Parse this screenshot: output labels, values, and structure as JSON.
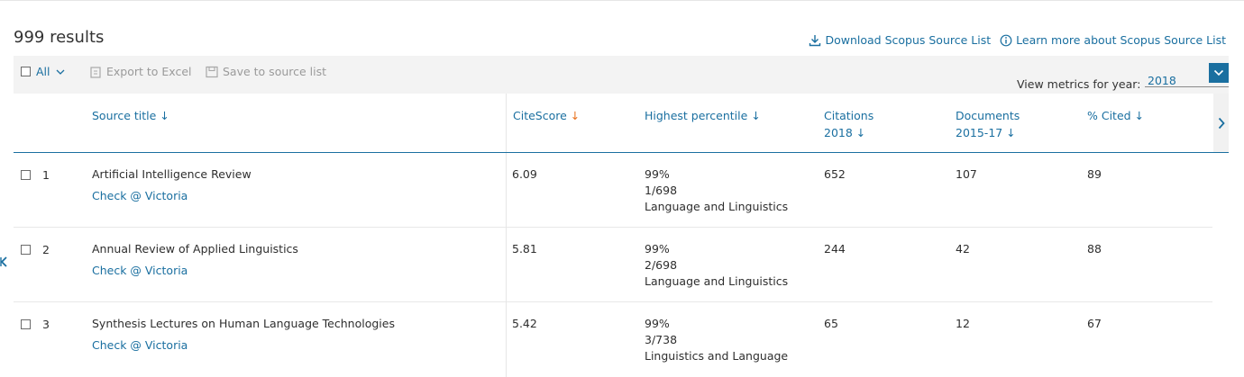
{
  "results_label": "999 results",
  "top_links": {
    "download": "Download Scopus Source List",
    "learn_more": "Learn more about Scopus Source List"
  },
  "toolbar": {
    "all_label": "All",
    "export_label": "Export to Excel",
    "save_label": "Save to source list",
    "year_label": "View metrics for year:",
    "year_value": "2018"
  },
  "headers": {
    "source_title": "Source title",
    "citescore": "CiteScore",
    "highest_percentile": "Highest percentile",
    "citations_line1": "Citations",
    "citations_line2": "2018",
    "documents_line1": "Documents",
    "documents_line2": "2015-17",
    "cited": "% Cited"
  },
  "rows": [
    {
      "num": "1",
      "title": "Artificial Intelligence Review",
      "link": "Check @ Victoria",
      "citescore": "6.09",
      "pct": "99%",
      "rank": "1/698",
      "category": "Language and Linguistics",
      "citations": "652",
      "documents": "107",
      "cited": "89"
    },
    {
      "num": "2",
      "title": "Annual Review of Applied Linguistics",
      "link": "Check @ Victoria",
      "citescore": "5.81",
      "pct": "99%",
      "rank": "2/698",
      "category": "Language and Linguistics",
      "citations": "244",
      "documents": "42",
      "cited": "88"
    },
    {
      "num": "3",
      "title": "Synthesis Lectures on Human Language Technologies",
      "link": "Check @ Victoria",
      "citescore": "5.42",
      "pct": "99%",
      "rank": "3/738",
      "category": "Linguistics and Language",
      "citations": "65",
      "documents": "12",
      "cited": "67"
    }
  ],
  "colors": {
    "link": "#1a6fa0",
    "sort_active": "#e9711c",
    "toolbar_bg": "#f3f3f3"
  }
}
